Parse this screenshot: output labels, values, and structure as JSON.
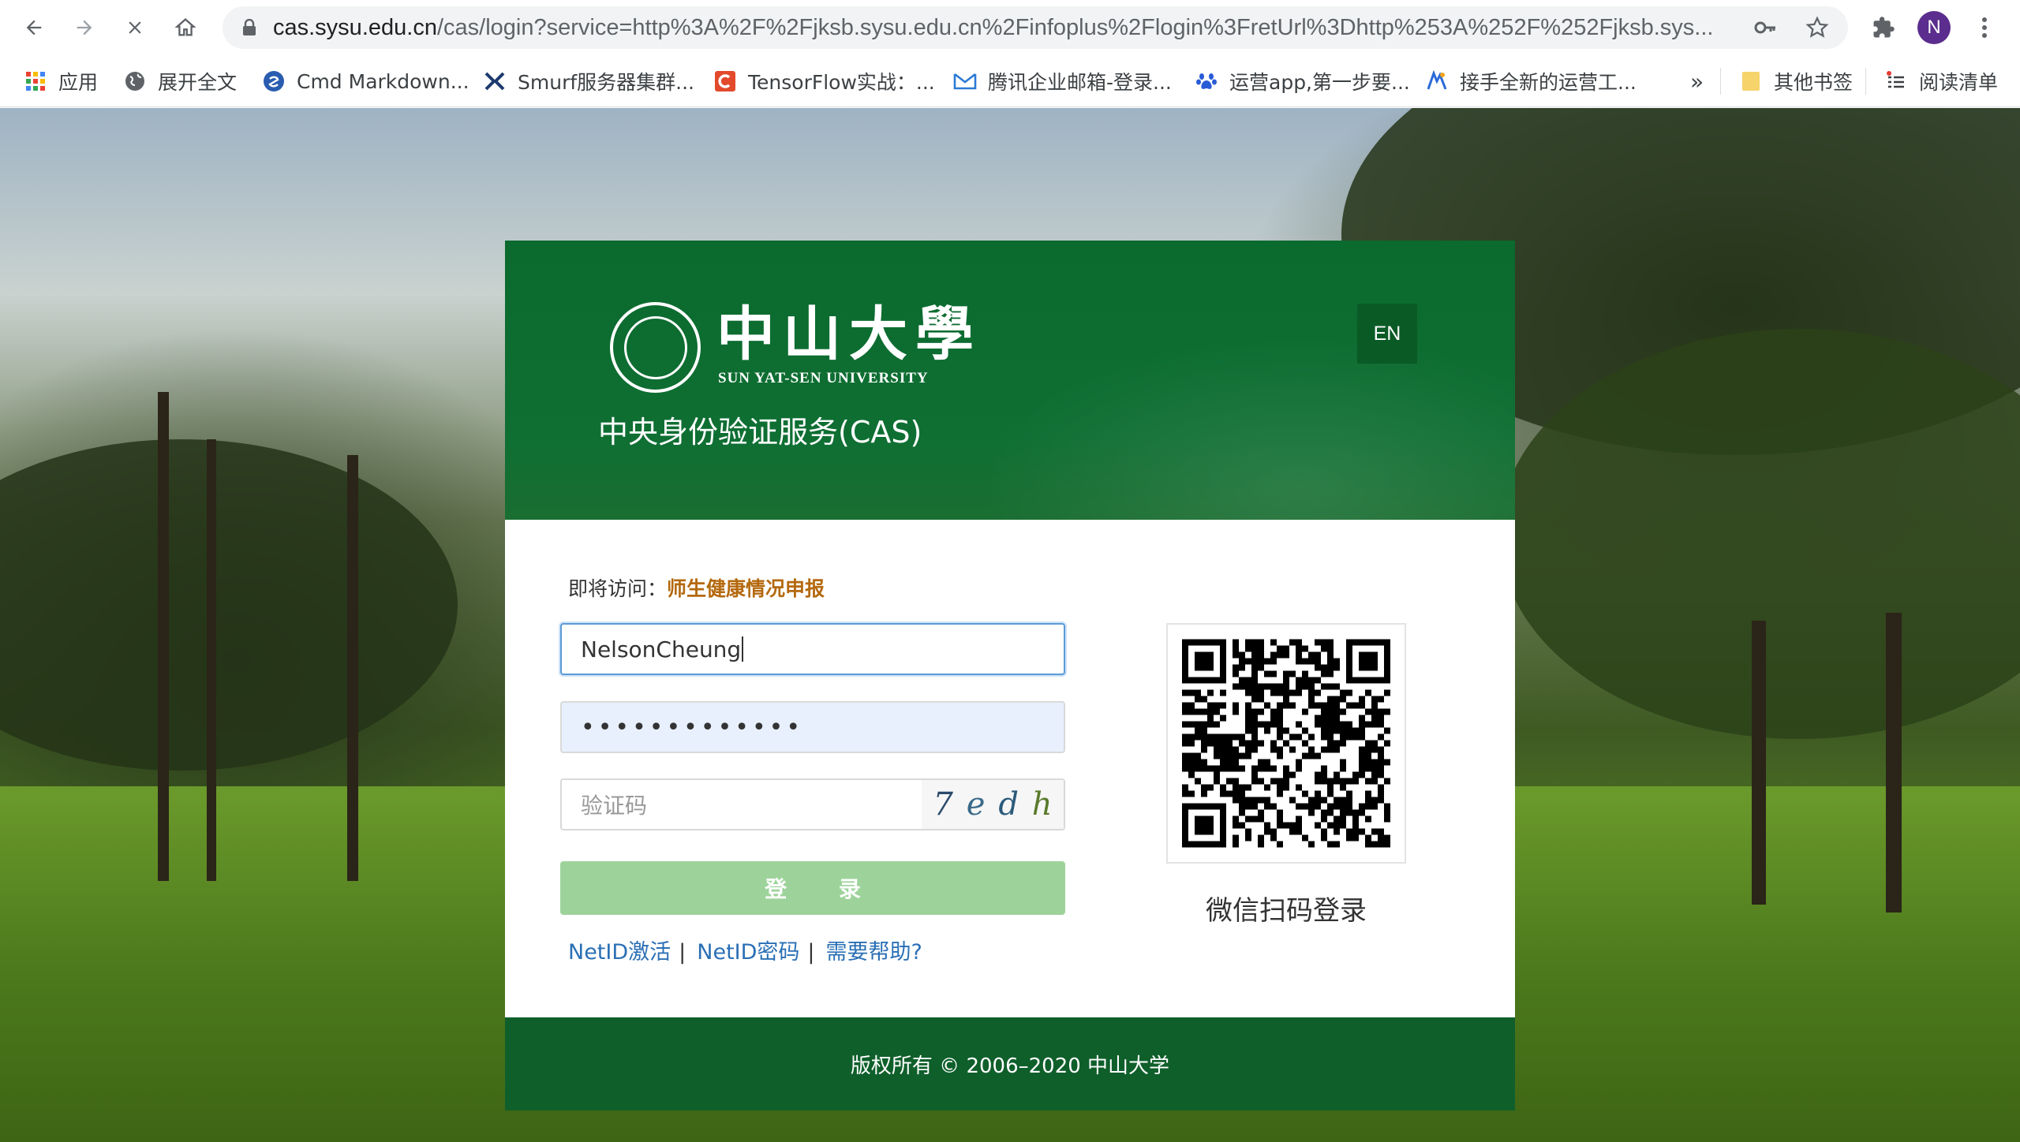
{
  "browser": {
    "url_host": "cas.sysu.edu.cn",
    "url_path": "/cas/login?service=http%3A%2F%2Fjksb.sysu.edu.cn%2Finfoplus%2Flogin%3FretUrl%3Dhttp%253A%252F%252Fjksb.sys...",
    "profile_initial": "N",
    "bookmarks": [
      {
        "label": "应用",
        "icon": "apps-grid-icon"
      },
      {
        "label": "展开全文",
        "icon": "globe-icon"
      },
      {
        "label": "Cmd Markdown...",
        "icon": "cmd-markdown-icon"
      },
      {
        "label": "Smurf服务器集群...",
        "icon": "smurf-icon"
      },
      {
        "label": "TensorFlow实战：...",
        "icon": "tensorflow-c-icon"
      },
      {
        "label": "腾讯企业邮箱-登录...",
        "icon": "tencent-mail-icon"
      },
      {
        "label": "运营app,第一步要...",
        "icon": "baidu-paw-icon"
      },
      {
        "label": "接手全新的运营工...",
        "icon": "blue-logo-icon"
      }
    ],
    "overflow_label": "»",
    "other_bookmarks": "其他书签",
    "reading_list": "阅读清单"
  },
  "header": {
    "logo_cn": "中山大學",
    "logo_en": "SUN YAT-SEN UNIVERSITY",
    "title": "中央身份验证服务(CAS)",
    "lang_button": "EN"
  },
  "form": {
    "visit_prefix": "即将访问：",
    "visit_target": "师生健康情况申报",
    "username_value": "NelsonCheung",
    "password_mask": "•••••••••••••",
    "captcha_placeholder": "验证码",
    "captcha_chars": [
      "7",
      "e",
      "d",
      "h"
    ],
    "login_button": "登 录",
    "links": [
      {
        "label": "NetID激活"
      },
      {
        "label": "NetID密码"
      },
      {
        "label": "需要帮助?"
      }
    ],
    "link_separator": "|"
  },
  "qr": {
    "caption": "微信扫码登录"
  },
  "footer": {
    "copyright": "版权所有 © 2006–2020 中山大学"
  },
  "colors": {
    "brand_green": "#0f6f33",
    "footer_green": "#0f5f2b",
    "button_green": "#9dd39a",
    "link_blue": "#2a6fb5",
    "visit_orange": "#b4690e"
  }
}
